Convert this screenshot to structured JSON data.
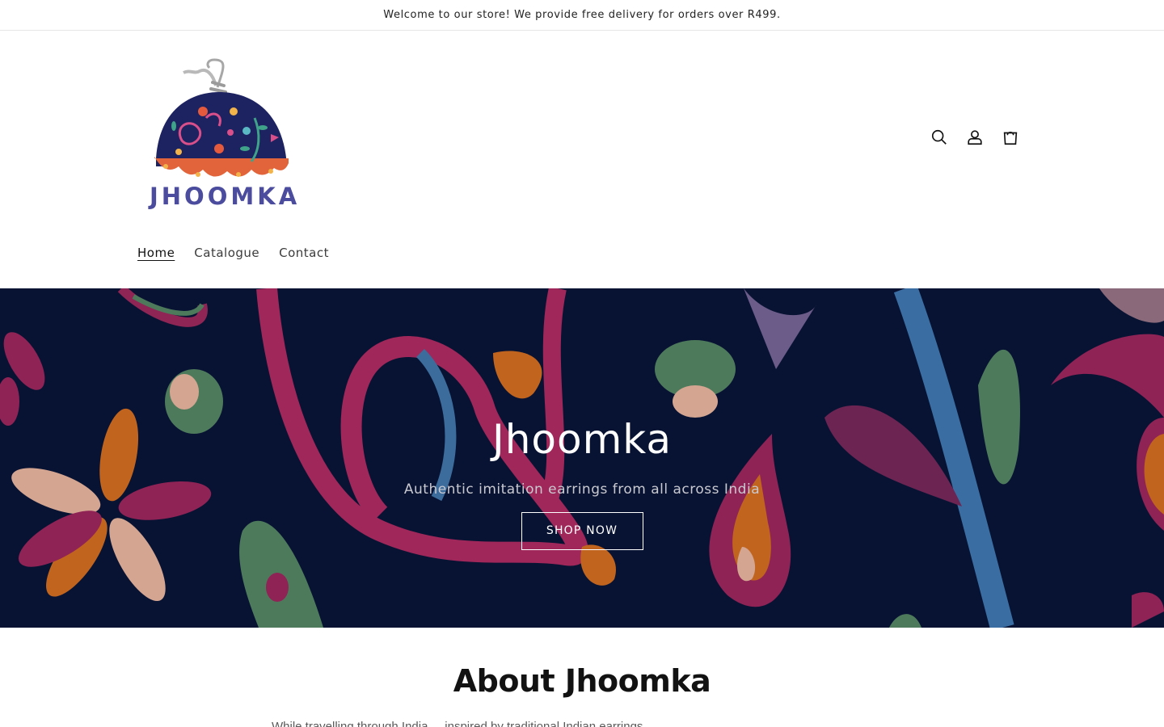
{
  "announcement": {
    "text": "Welcome to our store! We provide free delivery for orders over R499."
  },
  "header": {
    "logo_text": "JHOOMKA",
    "icons": [
      "search-icon",
      "account-icon",
      "cart-icon"
    ],
    "nav": [
      {
        "label": "Home",
        "active": true
      },
      {
        "label": "Catalogue",
        "active": false
      },
      {
        "label": "Contact",
        "active": false
      }
    ]
  },
  "hero": {
    "title": "Jhoomka",
    "subtitle": "Authentic imitation earrings from all across India",
    "button": "SHOP NOW"
  },
  "about": {
    "title": "About Jhoomka",
    "text": "While travelling through India ... inspired by traditional Indian earrings ..."
  },
  "colors": {
    "hero_bg": "#081333",
    "logo_text": "#4b4c9e",
    "pink": "#b02a5e",
    "orange": "#c0641e",
    "green": "#4e7a5c",
    "blue": "#3b6c9c",
    "purple": "#7a2a5e",
    "peach": "#d4a591"
  }
}
